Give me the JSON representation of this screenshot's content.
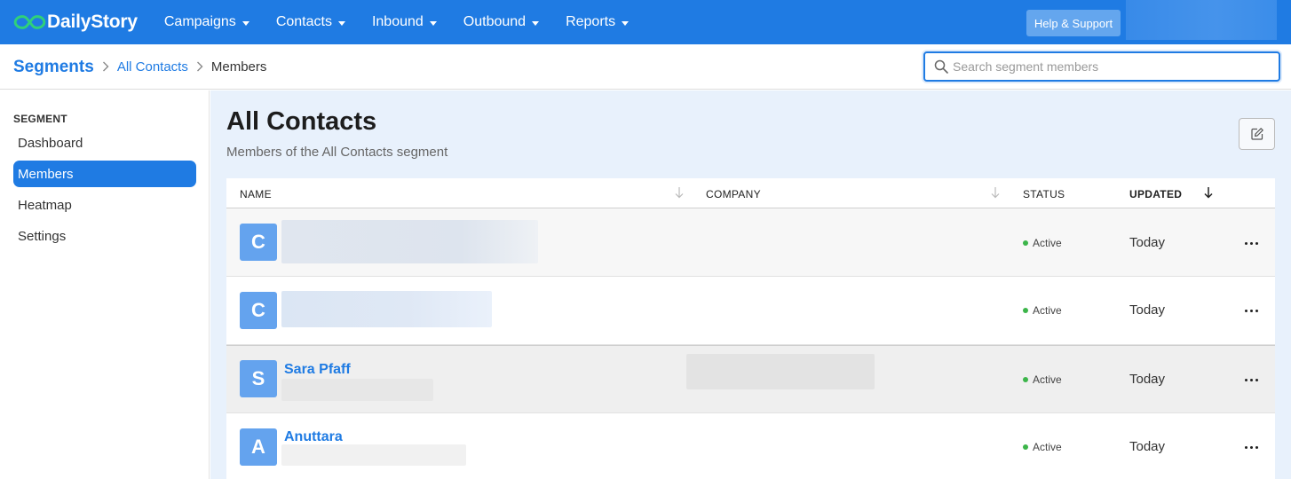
{
  "app": {
    "logo_text": "DailyStory",
    "accent": "#1f7be3"
  },
  "nav": {
    "items": [
      {
        "label": "Campaigns"
      },
      {
        "label": "Contacts"
      },
      {
        "label": "Inbound"
      },
      {
        "label": "Outbound"
      },
      {
        "label": "Reports"
      }
    ],
    "help_label": "Help & Support"
  },
  "breadcrumb": {
    "root": "Segments",
    "parent": "All Contacts",
    "current": "Members"
  },
  "search": {
    "placeholder": "Search segment members",
    "value": ""
  },
  "sidebar": {
    "heading": "SEGMENT",
    "items": [
      {
        "label": "Dashboard",
        "active": false
      },
      {
        "label": "Members",
        "active": true
      },
      {
        "label": "Heatmap",
        "active": false
      },
      {
        "label": "Settings",
        "active": false
      }
    ]
  },
  "page": {
    "title": "All Contacts",
    "subtitle": "Members of the All Contacts segment"
  },
  "table": {
    "columns": {
      "name": "NAME",
      "company": "COMPANY",
      "status": "STATUS",
      "updated": "UPDATED"
    },
    "rows": [
      {
        "initial": "C",
        "name": "",
        "status": "Active",
        "updated": "Today"
      },
      {
        "initial": "C",
        "name": "",
        "status": "Active",
        "updated": "Today"
      },
      {
        "initial": "S",
        "name": "Sara Pfaff",
        "status": "Active",
        "updated": "Today"
      },
      {
        "initial": "A",
        "name": "Anuttara",
        "status": "Active",
        "updated": "Today"
      }
    ]
  }
}
